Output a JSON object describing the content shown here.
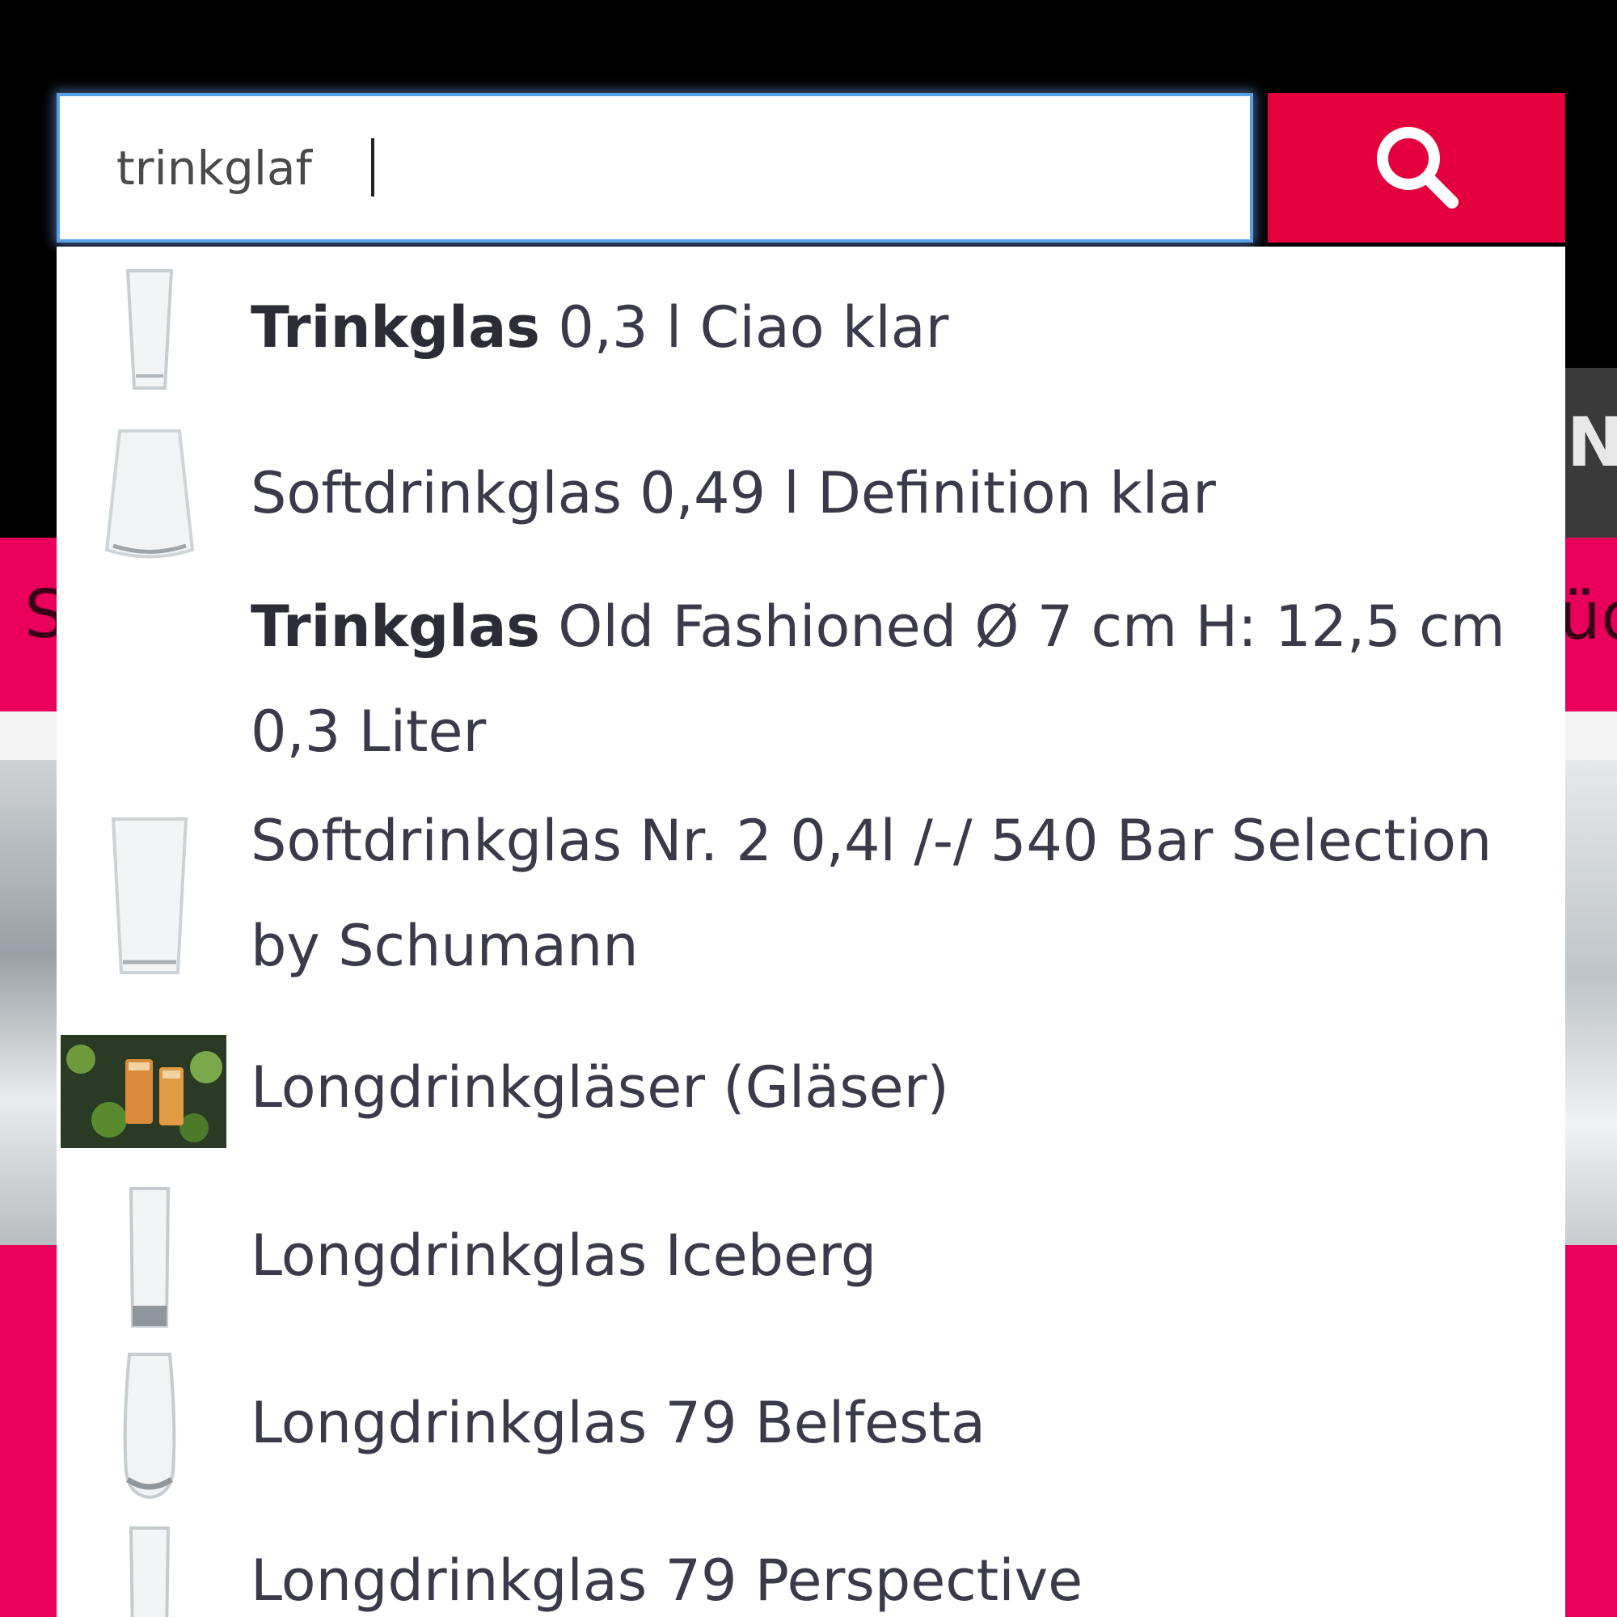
{
  "search": {
    "value": "trinkglaf"
  },
  "background": {
    "nav_partial_label": "N",
    "pink_band_left_partial": "S",
    "pink_band_right_partial": "üd"
  },
  "suggestions": [
    {
      "bold": "Trinkglas",
      "rest": " 0,3 l Ciao klar",
      "thumb": "glass-tall"
    },
    {
      "bold": "",
      "rest": "Softdrinkglas 0,49 l Definition klar",
      "thumb": "glass-wide"
    },
    {
      "bold": "Trinkglas",
      "rest": " Old Fashioned Ø 7 cm H: 12,5 cm 0,3 Liter",
      "thumb": "none"
    },
    {
      "bold": "",
      "rest": "Softdrinkglas Nr. 2 0,4l /-/ 540 Bar Selection by Schumann",
      "thumb": "glass-tumbler"
    },
    {
      "bold": "",
      "rest": "Longdrinkgläser (Gläser)",
      "thumb": "category-photo"
    },
    {
      "bold": "",
      "rest": "Longdrinkglas Iceberg",
      "thumb": "glass-slim"
    },
    {
      "bold": "",
      "rest": "Longdrinkglas 79 Belfesta",
      "thumb": "glass-curved"
    },
    {
      "bold": "",
      "rest": "Longdrinkglas 79 Perspective",
      "thumb": "glass-slim"
    }
  ],
  "colors": {
    "accent": "#e4003c",
    "pink_background": "#e8005a",
    "header_background": "#000000",
    "focus_outline": "#5aa0e6"
  }
}
